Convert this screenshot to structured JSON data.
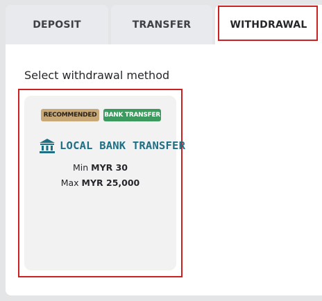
{
  "tabs": [
    {
      "label": "DEPOSIT",
      "active": false
    },
    {
      "label": "TRANSFER",
      "active": false
    },
    {
      "label": "WITHDRAWAL",
      "active": true
    }
  ],
  "heading": "Select withdrawal method",
  "methods": [
    {
      "badges": [
        {
          "label": "RECOMMENDED",
          "color": "#c8a876"
        },
        {
          "label": "BANK TRANSFER",
          "color": "#3d9a5f"
        }
      ],
      "logo_icon": "bank-building-icon",
      "logo_text": "LOCAL BANK TRANSFER",
      "min_label": "Min",
      "min_amount": "MYR 30",
      "max_label": "Max",
      "max_amount": "MYR 25,000"
    }
  ],
  "colors": {
    "accent_outline": "#cc1f1f",
    "logo_teal": "#1e6e84"
  }
}
